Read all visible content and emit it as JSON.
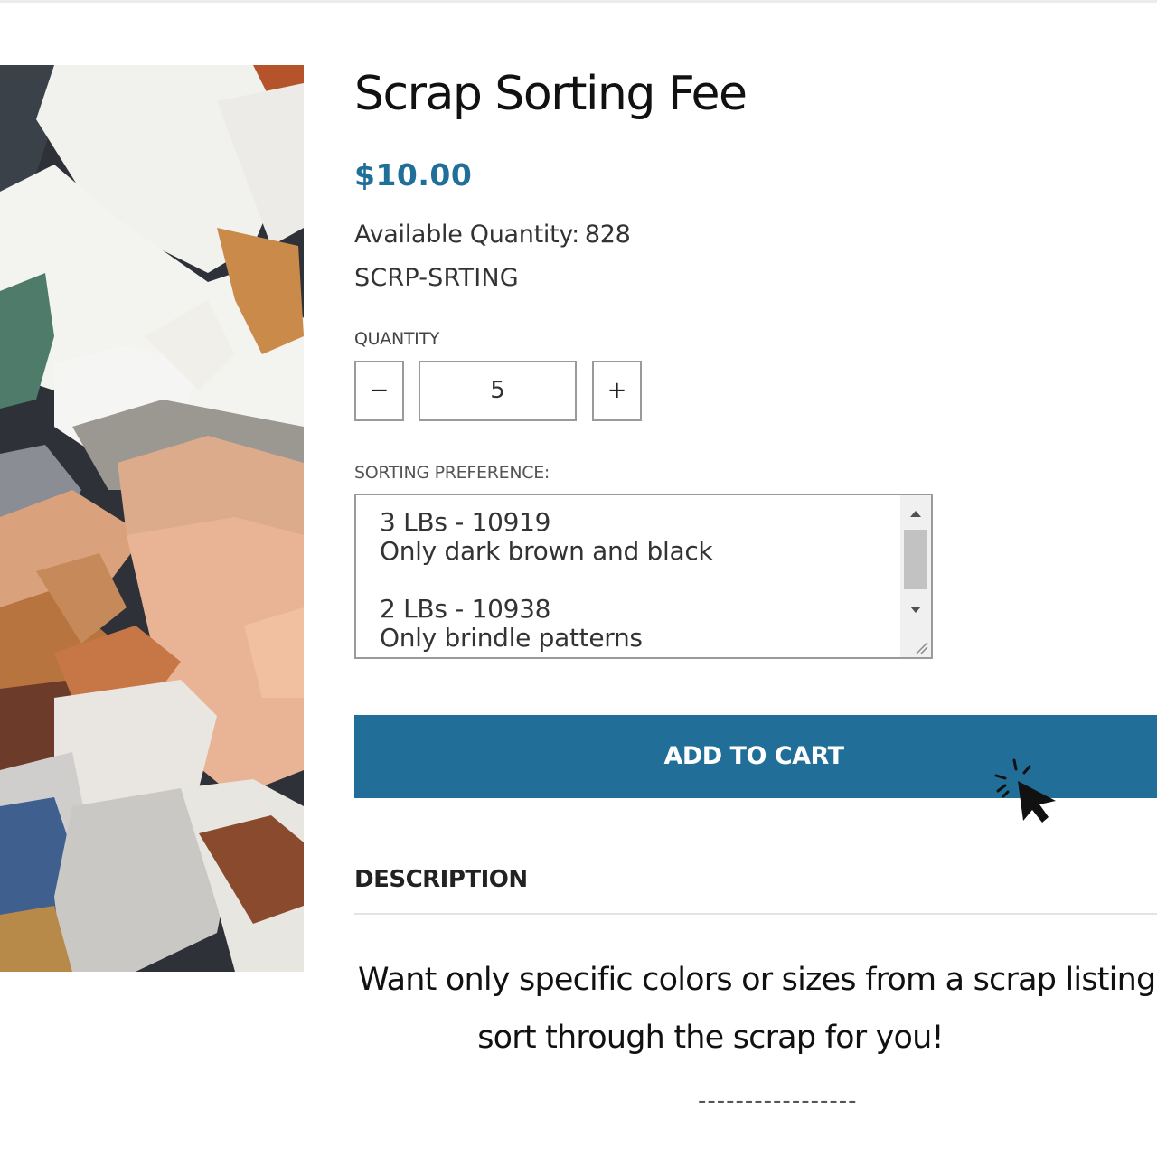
{
  "product": {
    "title": "Scrap Sorting Fee",
    "price": "$10.00",
    "availability_label": "Available Quantity:",
    "availability_value": "828",
    "sku": "SCRP-SRTING",
    "image_icon": "leather-scraps-photo"
  },
  "quantity": {
    "label": "QUANTITY",
    "minus_symbol": "−",
    "plus_symbol": "+",
    "value": "5"
  },
  "sorting": {
    "label": "SORTING PREFERENCE:",
    "lines": [
      "3 LBs - 10919",
      "Only dark brown and black",
      "",
      "2 LBs - 10938",
      "Only brindle patterns"
    ]
  },
  "cart": {
    "button_label": "ADD TO CART"
  },
  "description": {
    "heading": "DESCRIPTION",
    "line1": "Want only specific colors or sizes from a scrap listing?",
    "line2": "sort through the scrap for you!",
    "separator": "-----------------"
  },
  "colors": {
    "accent": "#216f98",
    "price": "#1f6f99",
    "border": "#9a9a9a"
  }
}
